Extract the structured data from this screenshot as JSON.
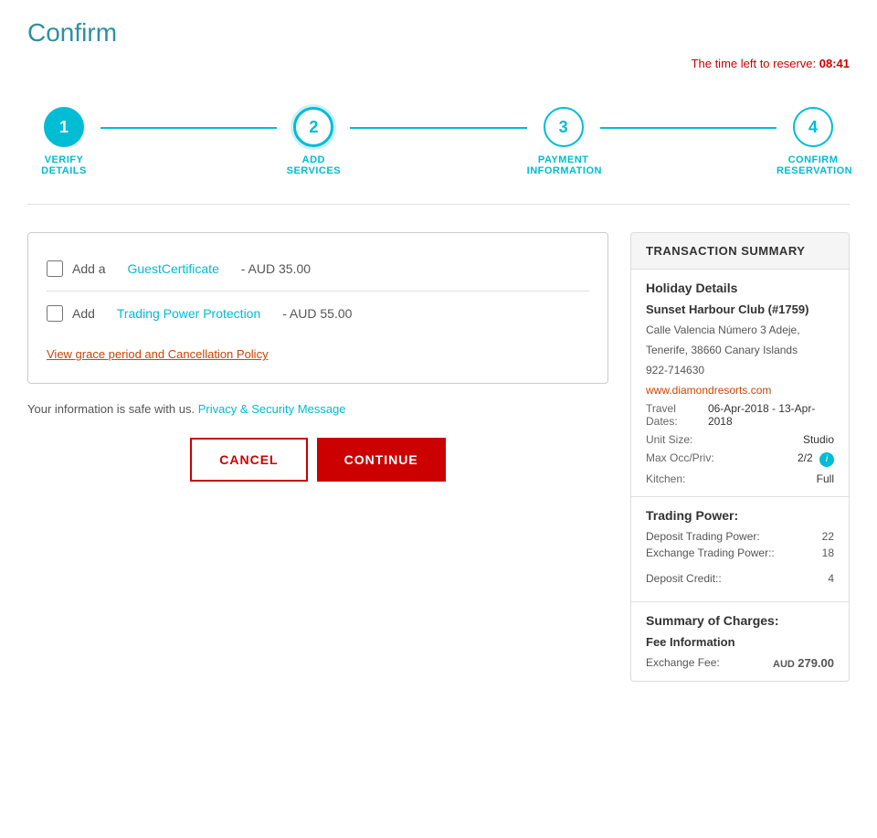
{
  "page": {
    "title": "Confirm",
    "timer_label": "The time left to reserve:",
    "timer_value": "08:41"
  },
  "stepper": {
    "steps": [
      {
        "number": "1",
        "label": "VERIFY DETAILS",
        "state": "completed"
      },
      {
        "number": "2",
        "label": "ADD SERVICES",
        "state": "active"
      },
      {
        "number": "3",
        "label": "PAYMENT\nINFORMATION",
        "state": "inactive"
      },
      {
        "number": "4",
        "label": "CONFIRM\nRESERVATION",
        "state": "inactive"
      }
    ]
  },
  "services": {
    "item1": {
      "prefix": "Add a",
      "link_text": "GuestCertificate",
      "suffix": "- AUD 35.00"
    },
    "item2": {
      "prefix": "Add",
      "link_text": "Trading Power Protection",
      "suffix": "- AUD 55.00"
    },
    "cancel_policy": "View grace period and Cancellation Policy"
  },
  "security": {
    "text": "Your information is safe with us.",
    "link_text": "Privacy & Security Message"
  },
  "buttons": {
    "cancel": "CANCEL",
    "continue": "CONTINUE"
  },
  "transaction": {
    "header": "TRANSACTION SUMMARY",
    "holiday": {
      "title": "Holiday Details",
      "resort_name": "Sunset Harbour Club (#1759)",
      "address": "Calle Valencia Número 3 Adeje,",
      "city": "Tenerife,  38660  Canary Islands",
      "phone": "922-714630",
      "website": "www.diamondresorts.com",
      "travel_dates_label": "Travel Dates:",
      "travel_dates_value": "06-Apr-2018 - 13-Apr-2018",
      "unit_size_label": "Unit Size:",
      "unit_size_value": "Studio",
      "max_occ_label": "Max Occ/Priv:",
      "max_occ_value": "2/2",
      "kitchen_label": "Kitchen:",
      "kitchen_value": "Full"
    },
    "trading_power": {
      "title": "Trading Power:",
      "deposit_label": "Deposit Trading Power:",
      "deposit_value": "22",
      "exchange_label": "Exchange Trading Power::",
      "exchange_value": "18",
      "deposit_credit_label": "Deposit Credit::",
      "deposit_credit_value": "4"
    },
    "charges": {
      "title": "Summary of Charges:",
      "fee_info_label": "Fee Information",
      "exchange_fee_label": "Exchange Fee:",
      "exchange_fee_currency": "AUD",
      "exchange_fee_value": "279.00"
    }
  }
}
